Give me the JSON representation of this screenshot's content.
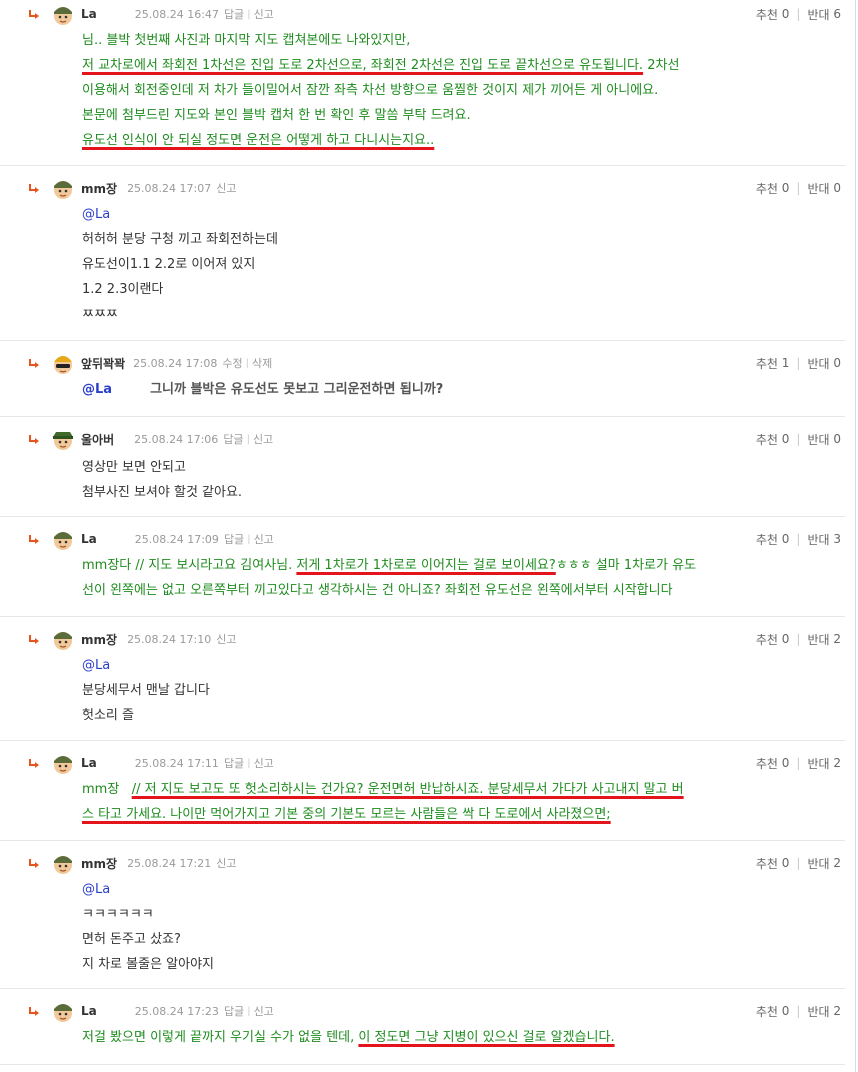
{
  "labels": {
    "reply": "답글",
    "report": "신고",
    "edit": "수정",
    "delete": "삭제",
    "up": "추천",
    "down": "반대"
  },
  "comments": [
    {
      "nick": "La",
      "date": "25.08.24 16:47",
      "up": "0",
      "down": "6",
      "lines": [
        "님.. 블박 첫번째 사진과 마지막 지도 캡쳐본에도 나와있지만,",
        "저 교차로에서 좌회전 1차선은 진입 도로 2차선으로, 좌회전 2차선은 진입 도로 끝차선으로 유도됩니다.",
        " 2차선",
        "이용해서 회전중인데 저 차가 들이밀어서 잠깐 좌측 차선 방향으로 움찔한 것이지 제가 끼어든 게 아니에요.",
        "본문에 첨부드린 지도와 본인 블박 캡처 한 번 확인 후 말씀 부탁 드려요.",
        "유도선 인식이 안 되실 정도면 운전은 어떻게 하고 다니시는지요.."
      ]
    },
    {
      "nick": "mm장",
      "date": "25.08.24 17:07",
      "up": "0",
      "down": "0",
      "mention": "@La",
      "lines": [
        "허허허 분당 구청 끼고 좌회전하는데",
        "유도선이1.1 2.2로 이어져 있지",
        "1.2 2.3이랜다",
        "ㅉㅉㅉ"
      ]
    },
    {
      "nick": "앞뒤꽉꽉",
      "date": "25.08.24 17:08",
      "up": "1",
      "down": "0",
      "mention": "@La",
      "lines": [
        "그니까 블박은 유도선도 못보고 그리운전하면 됩니까?"
      ]
    },
    {
      "nick": "울아버",
      "date": "25.08.24 17:06",
      "up": "0",
      "down": "0",
      "lines": [
        "영상만 보면 안되고",
        "첨부사진 보셔야 할것 같아요."
      ]
    },
    {
      "nick": "La",
      "date": "25.08.24 17:09",
      "up": "0",
      "down": "3",
      "lines": [
        "mm장다 // 지도 보시라고요 김여사님. ",
        "저게 1차로가 1차로로 이어지는 걸로 보이세요?",
        "ㅎㅎㅎ 설마 1차로가 유도",
        "선이 왼쪽에는 없고 오른쪽부터 끼고있다고 생각하시는 건 아니죠? 좌회전 유도선은 왼쪽에서부터 시작합니다"
      ]
    },
    {
      "nick": "mm장",
      "date": "25.08.24 17:10",
      "up": "0",
      "down": "2",
      "mention": "@La",
      "lines": [
        "분당세무서 맨날 갑니다",
        "헛소리 즐"
      ]
    },
    {
      "nick": "La",
      "date": "25.08.24 17:11",
      "up": "0",
      "down": "2",
      "lines": [
        "mm장   ",
        "// 저 지도 보고도 또 헛소리하시는 건가요? 운전면허 반납하시죠. 분당세무서 가다가 사고내지 말고 버",
        "스 타고 가세요. 나이만 먹어가지고 기본 중의 기본도 모르는 사람들은 싹 다 도로에서 사라졌으면;"
      ]
    },
    {
      "nick": "mm장",
      "date": "25.08.24 17:21",
      "up": "0",
      "down": "2",
      "mention": "@La",
      "lines": [
        "ㅋㅋㅋㅋㅋㅋ",
        "면허 돈주고 샀죠?",
        "지 차로 볼줄은 알아야지"
      ]
    },
    {
      "nick": "La",
      "date": "25.08.24 17:23",
      "up": "0",
      "down": "2",
      "lines": [
        "저걸 봤으면 이렇게 끝까지 우기실 수가 없을 텐데, ",
        "이 정도면 그냥 지병이 있으신 걸로 알겠습니다."
      ]
    }
  ]
}
